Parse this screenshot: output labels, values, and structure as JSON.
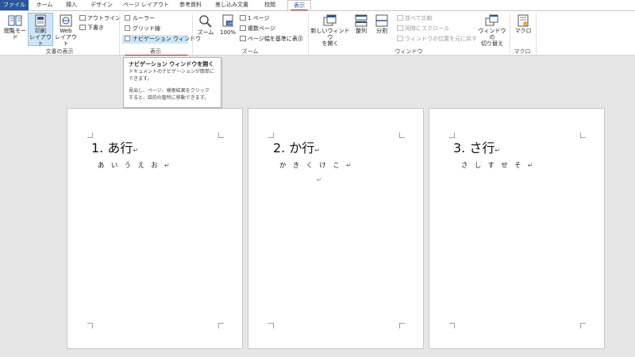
{
  "tabs": [
    {
      "label": "ファイル"
    },
    {
      "label": "ホーム"
    },
    {
      "label": "挿入"
    },
    {
      "label": "デザイン"
    },
    {
      "label": "ページ レイアウト"
    },
    {
      "label": "参考資料"
    },
    {
      "label": "差し込み文書"
    },
    {
      "label": "校閲"
    },
    {
      "label": "表示"
    }
  ],
  "ribbon": {
    "views": {
      "reading_mode": "閲覧モード",
      "print_layout_1": "印刷",
      "print_layout_2": "レイアウト",
      "web_layout_1": "Web",
      "web_layout_2": "レイアウト",
      "outline": "アウトライン",
      "draft": "下書き",
      "group_label": "文書の表示"
    },
    "show": {
      "ruler": "ルーラー",
      "gridlines": "グリッド線",
      "nav_pane": "ナビゲーション ウィンドウ",
      "group_label": "表示"
    },
    "zoom": {
      "zoom": "ズーム",
      "hundred": "100%",
      "one_page": "1 ページ",
      "multi_page": "複数ページ",
      "page_width": "ページ幅を基準に表示",
      "group_label": "ズーム"
    },
    "window": {
      "new_window_1": "新しいウィンドウ",
      "new_window_2": "を開く",
      "arrange_all": "整列",
      "split": "分割",
      "side_by_side": "並べて比較",
      "sync_scroll": "同時にスクロール",
      "reset_pos": "ウィンドウの位置を元に戻す",
      "switch_1": "ウィンドウの",
      "switch_2": "切り替え",
      "group_label": "ウィンドウ"
    },
    "macro": {
      "macro": "マクロ",
      "group_label": "マクロ"
    }
  },
  "tooltip": {
    "title": "ナビゲーション ウィンドウを開く",
    "line1": "ドキュメントのナビゲーションが簡単に",
    "line2": "できます。",
    "line3": "見出し、ページ、検索結果をクリック",
    "line4": "すると、目的の箇所に移動できます。"
  },
  "pages": [
    {
      "heading": "1. あ行",
      "sub": "あいうえお"
    },
    {
      "heading": "2. か行",
      "sub": "かきくけこ"
    },
    {
      "heading": "3. さ行",
      "sub": "さしすせそ"
    }
  ],
  "marks": {
    "return": "↵"
  },
  "colors": {
    "file_tab": "#2b579a",
    "highlight": "#cde6f7",
    "annotation_red": "#e81123"
  }
}
